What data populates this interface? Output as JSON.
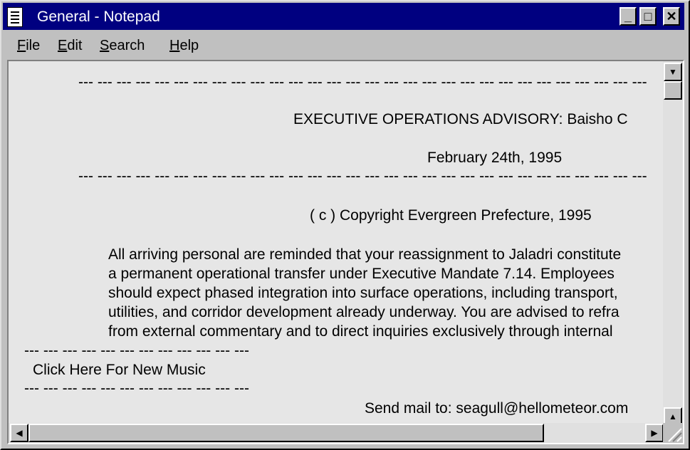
{
  "window": {
    "title": "General - Notepad"
  },
  "title_buttons": {
    "minimize": "_",
    "maximize": "□",
    "close": "✕"
  },
  "menu": {
    "file": {
      "accel": "F",
      "rest": "ile"
    },
    "edit": {
      "accel": "E",
      "rest": "dit"
    },
    "search": {
      "accel": "S",
      "rest": "earch"
    },
    "help": {
      "accel": "H",
      "rest": "elp"
    }
  },
  "document": {
    "rule_long": "--- --- --- --- --- --- --- --- --- --- --- --- --- --- --- --- --- --- --- --- --- --- --- --- --- --- --- --- --- ---",
    "heading": "EXECUTIVE OPERATIONS ADVISORY: Baisho C",
    "date": "February 24th, 1995",
    "copyright": "( c ) Copyright Evergreen Prefecture, 1995",
    "body": [
      "All arriving personal are reminded that your reassignment to Jaladri constitute",
      "a permanent operational transfer under Executive Mandate 7.14. Employees",
      "should expect phased integration into surface operations, including transport,",
      "utilities, and corridor development already underway. You are advised to refra",
      "from external commentary and to direct inquiries exclusively through internal"
    ],
    "rule_short": "--- --- --- --- --- --- --- --- --- --- --- ---",
    "music_link": "Click Here For New Music",
    "mail": "Send mail to: seagull@hellometeor.com"
  },
  "scrollbars": {
    "up": "▲",
    "down": "▼",
    "left": "◀",
    "right": "▶"
  }
}
